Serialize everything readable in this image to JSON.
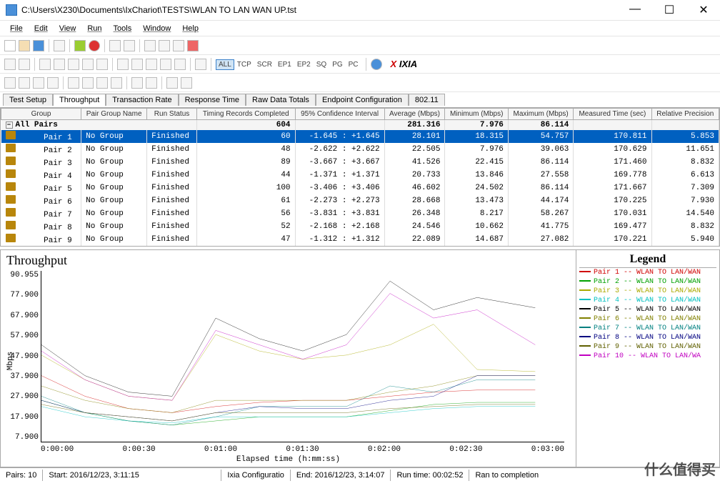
{
  "window": {
    "title_path": "C:\\Users\\X230\\Documents\\IxChariot\\TESTS\\WLAN TO LAN WAN UP.tst",
    "min": "—",
    "max": "☐",
    "close": "✕"
  },
  "menu": [
    "File",
    "Edit",
    "View",
    "Run",
    "Tools",
    "Window",
    "Help"
  ],
  "toolbar2_tags": [
    "ALL",
    "TCP",
    "SCR",
    "EP1",
    "EP2",
    "SQ",
    "PG",
    "PC"
  ],
  "logo": "IXIA",
  "tabs": [
    "Test Setup",
    "Throughput",
    "Transaction Rate",
    "Response Time",
    "Raw Data Totals",
    "Endpoint Configuration",
    "802.11"
  ],
  "active_tab": 1,
  "columns": [
    "Group",
    "Pair Group Name",
    "Run Status",
    "Timing Records Completed",
    "95% Confidence Interval",
    "Average (Mbps)",
    "Minimum (Mbps)",
    "Maximum (Mbps)",
    "Measured Time (sec)",
    "Relative Precision"
  ],
  "allpairs": {
    "label": "All Pairs",
    "timing": "604",
    "avg": "281.316",
    "min": "7.976",
    "max": "86.114"
  },
  "rows": [
    {
      "pair": "Pair 1",
      "grp": "No Group",
      "status": "Finished",
      "tim": "60",
      "ci": "-1.645 : +1.645",
      "avg": "28.101",
      "min": "18.315",
      "max": "54.757",
      "mt": "170.811",
      "rp": "5.853",
      "sel": true
    },
    {
      "pair": "Pair 2",
      "grp": "No Group",
      "status": "Finished",
      "tim": "48",
      "ci": "-2.622 : +2.622",
      "avg": "22.505",
      "min": "7.976",
      "max": "39.063",
      "mt": "170.629",
      "rp": "11.651"
    },
    {
      "pair": "Pair 3",
      "grp": "No Group",
      "status": "Finished",
      "tim": "89",
      "ci": "-3.667 : +3.667",
      "avg": "41.526",
      "min": "22.415",
      "max": "86.114",
      "mt": "171.460",
      "rp": "8.832"
    },
    {
      "pair": "Pair 4",
      "grp": "No Group",
      "status": "Finished",
      "tim": "44",
      "ci": "-1.371 : +1.371",
      "avg": "20.733",
      "min": "13.846",
      "max": "27.558",
      "mt": "169.778",
      "rp": "6.613"
    },
    {
      "pair": "Pair 5",
      "grp": "No Group",
      "status": "Finished",
      "tim": "100",
      "ci": "-3.406 : +3.406",
      "avg": "46.602",
      "min": "24.502",
      "max": "86.114",
      "mt": "171.667",
      "rp": "7.309"
    },
    {
      "pair": "Pair 6",
      "grp": "No Group",
      "status": "Finished",
      "tim": "61",
      "ci": "-2.273 : +2.273",
      "avg": "28.668",
      "min": "13.473",
      "max": "44.174",
      "mt": "170.225",
      "rp": "7.930"
    },
    {
      "pair": "Pair 7",
      "grp": "No Group",
      "status": "Finished",
      "tim": "56",
      "ci": "-3.831 : +3.831",
      "avg": "26.348",
      "min": "8.217",
      "max": "58.267",
      "mt": "170.031",
      "rp": "14.540"
    },
    {
      "pair": "Pair 8",
      "grp": "No Group",
      "status": "Finished",
      "tim": "52",
      "ci": "-2.168 : +2.168",
      "avg": "24.546",
      "min": "10.662",
      "max": "41.775",
      "mt": "169.477",
      "rp": "8.832"
    },
    {
      "pair": "Pair 9",
      "grp": "No Group",
      "status": "Finished",
      "tim": "47",
      "ci": "-1.312 : +1.312",
      "avg": "22.089",
      "min": "14.687",
      "max": "27.082",
      "mt": "170.221",
      "rp": "5.940"
    }
  ],
  "chart": {
    "title": "Throughput",
    "ylabel": "Mbps",
    "xlabel": "Elapsed time (h:mm:ss)"
  },
  "chart_data": {
    "type": "line",
    "xlabel": "Elapsed time (h:mm:ss)",
    "ylabel": "Mbps",
    "title": "Throughput",
    "ylim": [
      7.9,
      90.955
    ],
    "yticks": [
      90.955,
      77.9,
      67.9,
      57.9,
      47.9,
      37.9,
      27.9,
      17.9,
      7.9
    ],
    "xticks": [
      "0:00:00",
      "0:00:30",
      "0:01:00",
      "0:01:30",
      "0:02:00",
      "0:02:30",
      "0:03:00"
    ],
    "x": [
      0,
      15,
      30,
      45,
      60,
      75,
      90,
      105,
      120,
      135,
      150,
      170
    ],
    "series": [
      {
        "name": "Pair 1 -- WLAN TO LAN/WAN",
        "color": "#d00000",
        "values": [
          40,
          30,
          24,
          22,
          25,
          27,
          28,
          28,
          30,
          32,
          33,
          33
        ]
      },
      {
        "name": "Pair 2 -- WLAN TO LAN/WAN",
        "color": "#00a000",
        "values": [
          28,
          22,
          18,
          16,
          18,
          20,
          20,
          20,
          23,
          26,
          27,
          27
        ]
      },
      {
        "name": "Pair 3 -- WLAN TO LAN/WAN",
        "color": [
          170,
          170,
          0
        ],
        "values": [
          50,
          38,
          30,
          28,
          60,
          52,
          48,
          50,
          55,
          65,
          43,
          42
        ]
      },
      {
        "name": "Pair 4 -- WLAN TO LAN/WAN",
        "color": "#00c0c0",
        "values": [
          25,
          20,
          18,
          17,
          20,
          20,
          20,
          20,
          22,
          24,
          25,
          25
        ]
      },
      {
        "name": "Pair 5 -- WLAN TO LAN/WAN",
        "color": "#000000",
        "values": [
          55,
          40,
          32,
          30,
          68,
          58,
          52,
          60,
          86,
          72,
          78,
          73
        ]
      },
      {
        "name": "Pair 6 -- WLAN TO LAN/WAN",
        "color": "#808000",
        "values": [
          35,
          28,
          24,
          22,
          28,
          28,
          28,
          28,
          32,
          35,
          40,
          40
        ]
      },
      {
        "name": "Pair 7 -- WLAN TO LAN/WAN",
        "color": "#008080",
        "values": [
          30,
          22,
          18,
          16,
          20,
          25,
          25,
          25,
          35,
          32,
          38,
          38
        ]
      },
      {
        "name": "Pair 8 -- WLAN TO LAN/WAN",
        "color": "#000080",
        "values": [
          28,
          22,
          20,
          18,
          22,
          25,
          24,
          24,
          28,
          30,
          40,
          40
        ]
      },
      {
        "name": "Pair 9 -- WLAN TO LAN/WAN",
        "color": "#606000",
        "values": [
          26,
          22,
          20,
          18,
          22,
          22,
          22,
          22,
          24,
          25,
          26,
          26
        ]
      },
      {
        "name": "Pair 10 -- WLAN TO LAN/WA",
        "color": "#c000c0",
        "values": [
          52,
          38,
          30,
          28,
          62,
          55,
          48,
          55,
          80,
          68,
          72,
          55
        ]
      }
    ]
  },
  "legend": {
    "title": "Legend"
  },
  "status": {
    "pairs": "Pairs: 10",
    "start": "Start: 2016/12/23, 3:11:15",
    "config": "Ixia Configuratio",
    "end": "End: 2016/12/23, 3:14:07",
    "runtime": "Run time: 00:02:52",
    "ran": "Ran to completion"
  },
  "watermark": "什么值得买"
}
